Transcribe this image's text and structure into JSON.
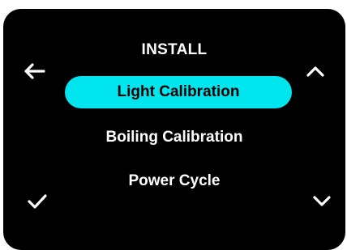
{
  "header": {
    "title": "INSTALL"
  },
  "menu": {
    "items": [
      {
        "label": "Light Calibration",
        "selected": true
      },
      {
        "label": "Boiling Calibration",
        "selected": false
      },
      {
        "label": "Power Cycle",
        "selected": false
      }
    ]
  },
  "icons": {
    "back": "arrow-left-icon",
    "up": "chevron-up-icon",
    "confirm": "check-icon",
    "down": "chevron-down-icon"
  },
  "colors": {
    "background": "#000000",
    "text": "#ffffff",
    "highlight": "#00e5ee",
    "highlight_text": "#000000"
  }
}
